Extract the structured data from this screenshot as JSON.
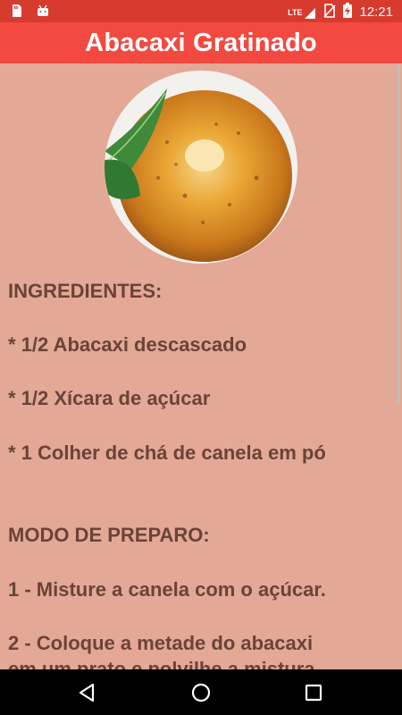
{
  "status_bar": {
    "network": "LTE",
    "time": "12:21",
    "icons": [
      "sd-card-icon",
      "android-icon",
      "lte-signal-icon",
      "no-sim-icon",
      "battery-charging-icon"
    ]
  },
  "app_bar": {
    "title": "Abacaxi Gratinado"
  },
  "recipe": {
    "image_icon": "pineapple-photo",
    "ingredients_heading": " INGREDIENTES:",
    "ingredients": [
      "* 1/2 Abacaxi descascado",
      "* 1/2 Xícara de açúcar",
      "* 1 Colher de chá de canela em pó"
    ],
    "method_heading": " MODO DE PREPARO:",
    "steps": [
      " 1 - Misture a canela com o açúcar.",
      " 2 - Coloque a metade do abacaxi",
      "em um prato e polvilhe a mistura"
    ]
  },
  "nav_bar": {
    "icons": [
      "back-icon",
      "home-icon",
      "recents-icon"
    ]
  },
  "colors": {
    "status_bar": "#d63b2e",
    "app_bar": "#f24a40",
    "background": "#e3a896",
    "text": "#6b4338"
  }
}
